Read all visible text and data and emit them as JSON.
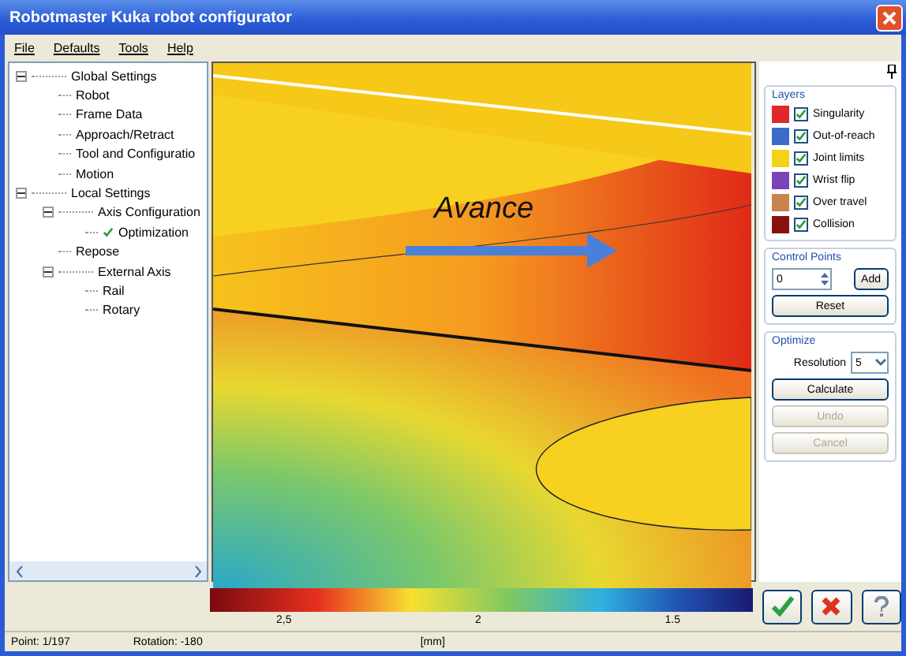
{
  "window": {
    "title": "Robotmaster Kuka robot configurator"
  },
  "menu": [
    "File",
    "Defaults",
    "Tools",
    "Help"
  ],
  "tree": [
    {
      "label": "Global Settings",
      "expanded": true,
      "checked": false,
      "children": [
        {
          "label": "Robot",
          "checked": false
        },
        {
          "label": "Frame Data",
          "checked": false
        },
        {
          "label": "Approach/Retract",
          "checked": false
        },
        {
          "label": "Tool and Configuratio",
          "checked": false
        },
        {
          "label": "Motion",
          "checked": false
        }
      ]
    },
    {
      "label": "Local Settings",
      "expanded": true,
      "checked": false,
      "children": [
        {
          "label": "Axis Configuration",
          "expanded": true,
          "checked": false,
          "children": [
            {
              "label": "Optimization",
              "checked": true
            }
          ]
        },
        {
          "label": "Repose",
          "checked": false
        },
        {
          "label": "External Axis",
          "expanded": true,
          "checked": false,
          "children": [
            {
              "label": "Rail",
              "checked": false
            },
            {
              "label": "Rotary",
              "checked": false
            }
          ]
        }
      ]
    }
  ],
  "annotation": {
    "text": "Avance"
  },
  "layers": {
    "title": "Layers",
    "items": [
      {
        "label": "Singularity",
        "color": "#e0282a",
        "checked": true
      },
      {
        "label": "Out-of-reach",
        "color": "#3a6cc8",
        "checked": true
      },
      {
        "label": "Joint limits",
        "color": "#f2d21a",
        "checked": true
      },
      {
        "label": "Wrist flip",
        "color": "#7a44b8",
        "checked": true
      },
      {
        "label": "Over travel",
        "color": "#c8844a",
        "checked": true
      },
      {
        "label": "Collision",
        "color": "#8a1010",
        "checked": true
      }
    ]
  },
  "control_points": {
    "title": "Control Points",
    "value": "0",
    "buttons": [
      {
        "label": "Add",
        "disabled": false
      },
      {
        "label": "Reset",
        "disabled": false
      }
    ]
  },
  "optimize": {
    "title": "Optimize",
    "resolution_label": "Resolution",
    "resolution": "5",
    "buttons": [
      {
        "label": "Calculate",
        "disabled": false
      },
      {
        "label": "Undo",
        "disabled": true
      },
      {
        "label": "Cancel",
        "disabled": true
      }
    ]
  },
  "colorbar": {
    "ticks": [
      "2,5",
      "2",
      "1.5"
    ],
    "unit": "[mm]"
  },
  "status_bar": {
    "point": "Point: 1/197",
    "rotation": "Rotation: -180"
  }
}
